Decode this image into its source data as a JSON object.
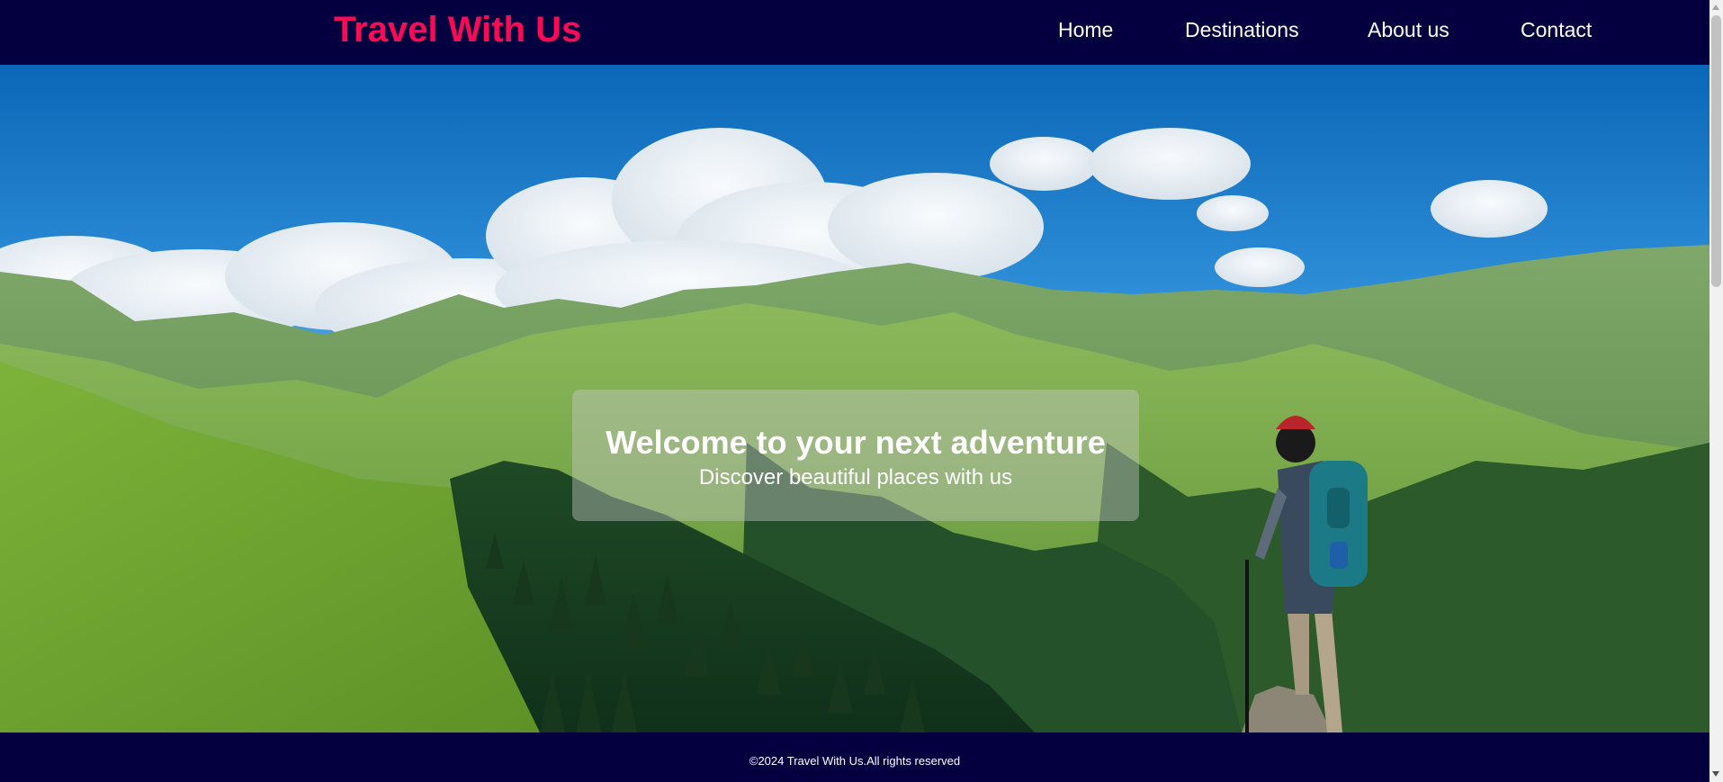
{
  "header": {
    "logo_text": "Travel With Us",
    "nav": [
      {
        "label": "Home"
      },
      {
        "label": "Destinations"
      },
      {
        "label": "About us"
      },
      {
        "label": "Contact"
      }
    ]
  },
  "hero": {
    "title": "Welcome to your next adventure",
    "subtitle": "Discover beautiful places with us"
  },
  "footer": {
    "copyright": "©2024 Travel With Us.All rights reserved"
  },
  "colors": {
    "header_bg": "#04003f",
    "logo": "#fc0a56",
    "nav_text": "#ffffff",
    "footer_bg": "#04003f"
  }
}
